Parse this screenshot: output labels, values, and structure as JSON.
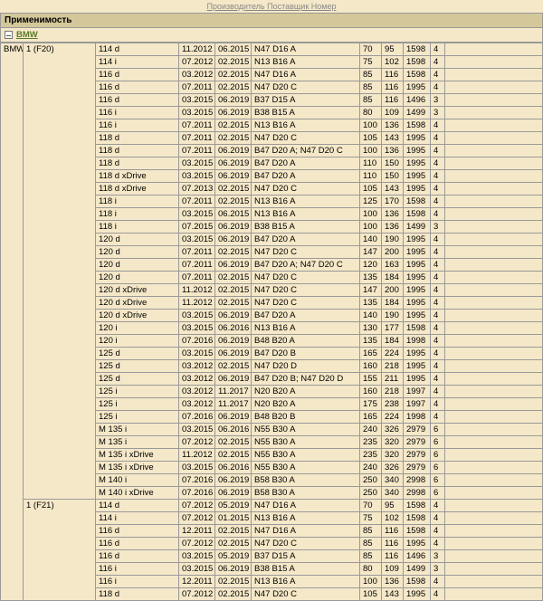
{
  "top_links": "Производитель Поставщик Номер",
  "section_title": "Применимость",
  "brand": "BMW",
  "maker": "BMW",
  "groups": [
    {
      "model": "1 (F20)",
      "rows": [
        {
          "v": "114 d",
          "f": "11.2012",
          "t": "06.2015",
          "e": "N47 D16 A",
          "a": 70,
          "b": 95,
          "c": 1598,
          "d": 4
        },
        {
          "v": "114 i",
          "f": "07.2012",
          "t": "02.2015",
          "e": "N13 B16 A",
          "a": 75,
          "b": 102,
          "c": 1598,
          "d": 4
        },
        {
          "v": "116 d",
          "f": "03.2012",
          "t": "02.2015",
          "e": "N47 D16 A",
          "a": 85,
          "b": 116,
          "c": 1598,
          "d": 4
        },
        {
          "v": "116 d",
          "f": "07.2011",
          "t": "02.2015",
          "e": "N47 D20 C",
          "a": 85,
          "b": 116,
          "c": 1995,
          "d": 4
        },
        {
          "v": "116 d",
          "f": "03.2015",
          "t": "06.2019",
          "e": "B37 D15 A",
          "a": 85,
          "b": 116,
          "c": 1496,
          "d": 3
        },
        {
          "v": "116 i",
          "f": "03.2015",
          "t": "06.2019",
          "e": "B38 B15 A",
          "a": 80,
          "b": 109,
          "c": 1499,
          "d": 3
        },
        {
          "v": "116 i",
          "f": "07.2011",
          "t": "02.2015",
          "e": "N13 B16 A",
          "a": 100,
          "b": 136,
          "c": 1598,
          "d": 4
        },
        {
          "v": "118 d",
          "f": "07.2011",
          "t": "02.2015",
          "e": "N47 D20 C",
          "a": 105,
          "b": 143,
          "c": 1995,
          "d": 4
        },
        {
          "v": "118 d",
          "f": "07.2011",
          "t": "06.2019",
          "e": "B47 D20 A; N47 D20 C",
          "a": 100,
          "b": 136,
          "c": 1995,
          "d": 4
        },
        {
          "v": "118 d",
          "f": "03.2015",
          "t": "06.2019",
          "e": "B47 D20 A",
          "a": 110,
          "b": 150,
          "c": 1995,
          "d": 4
        },
        {
          "v": "118 d xDrive",
          "f": "03.2015",
          "t": "06.2019",
          "e": "B47 D20 A",
          "a": 110,
          "b": 150,
          "c": 1995,
          "d": 4
        },
        {
          "v": "118 d xDrive",
          "f": "07.2013",
          "t": "02.2015",
          "e": "N47 D20 C",
          "a": 105,
          "b": 143,
          "c": 1995,
          "d": 4
        },
        {
          "v": "118 i",
          "f": "07.2011",
          "t": "02.2015",
          "e": "N13 B16 A",
          "a": 125,
          "b": 170,
          "c": 1598,
          "d": 4
        },
        {
          "v": "118 i",
          "f": "03.2015",
          "t": "06.2015",
          "e": "N13 B16 A",
          "a": 100,
          "b": 136,
          "c": 1598,
          "d": 4
        },
        {
          "v": "118 i",
          "f": "07.2015",
          "t": "06.2019",
          "e": "B38 B15 A",
          "a": 100,
          "b": 136,
          "c": 1499,
          "d": 3
        },
        {
          "v": "120 d",
          "f": "03.2015",
          "t": "06.2019",
          "e": "B47 D20 A",
          "a": 140,
          "b": 190,
          "c": 1995,
          "d": 4
        },
        {
          "v": "120 d",
          "f": "07.2011",
          "t": "02.2015",
          "e": "N47 D20 C",
          "a": 147,
          "b": 200,
          "c": 1995,
          "d": 4
        },
        {
          "v": "120 d",
          "f": "07.2011",
          "t": "06.2019",
          "e": "B47 D20 A; N47 D20 C",
          "a": 120,
          "b": 163,
          "c": 1995,
          "d": 4
        },
        {
          "v": "120 d",
          "f": "07.2011",
          "t": "02.2015",
          "e": "N47 D20 C",
          "a": 135,
          "b": 184,
          "c": 1995,
          "d": 4
        },
        {
          "v": "120 d xDrive",
          "f": "11.2012",
          "t": "02.2015",
          "e": "N47 D20 C",
          "a": 147,
          "b": 200,
          "c": 1995,
          "d": 4
        },
        {
          "v": "120 d xDrive",
          "f": "11.2012",
          "t": "02.2015",
          "e": "N47 D20 C",
          "a": 135,
          "b": 184,
          "c": 1995,
          "d": 4
        },
        {
          "v": "120 d xDrive",
          "f": "03.2015",
          "t": "06.2019",
          "e": "B47 D20 A",
          "a": 140,
          "b": 190,
          "c": 1995,
          "d": 4
        },
        {
          "v": "120 i",
          "f": "03.2015",
          "t": "06.2016",
          "e": "N13 B16 A",
          "a": 130,
          "b": 177,
          "c": 1598,
          "d": 4
        },
        {
          "v": "120 i",
          "f": "07.2016",
          "t": "06.2019",
          "e": "B48 B20 A",
          "a": 135,
          "b": 184,
          "c": 1998,
          "d": 4
        },
        {
          "v": "125 d",
          "f": "03.2015",
          "t": "06.2019",
          "e": "B47 D20 B",
          "a": 165,
          "b": 224,
          "c": 1995,
          "d": 4
        },
        {
          "v": "125 d",
          "f": "03.2012",
          "t": "02.2015",
          "e": "N47 D20 D",
          "a": 160,
          "b": 218,
          "c": 1995,
          "d": 4
        },
        {
          "v": "125 d",
          "f": "03.2012",
          "t": "06.2019",
          "e": "B47 D20 B; N47 D20 D",
          "a": 155,
          "b": 211,
          "c": 1995,
          "d": 4
        },
        {
          "v": "125 i",
          "f": "03.2012",
          "t": "11.2017",
          "e": "N20 B20 A",
          "a": 160,
          "b": 218,
          "c": 1997,
          "d": 4
        },
        {
          "v": "125 i",
          "f": "03.2012",
          "t": "11.2017",
          "e": "N20 B20 A",
          "a": 175,
          "b": 238,
          "c": 1997,
          "d": 4
        },
        {
          "v": "125 i",
          "f": "07.2016",
          "t": "06.2019",
          "e": "B48 B20 B",
          "a": 165,
          "b": 224,
          "c": 1998,
          "d": 4
        },
        {
          "v": "M 135 i",
          "f": "03.2015",
          "t": "06.2016",
          "e": "N55 B30 A",
          "a": 240,
          "b": 326,
          "c": 2979,
          "d": 6
        },
        {
          "v": "M 135 i",
          "f": "07.2012",
          "t": "02.2015",
          "e": "N55 B30 A",
          "a": 235,
          "b": 320,
          "c": 2979,
          "d": 6
        },
        {
          "v": "M 135 i xDrive",
          "f": "11.2012",
          "t": "02.2015",
          "e": "N55 B30 A",
          "a": 235,
          "b": 320,
          "c": 2979,
          "d": 6
        },
        {
          "v": "M 135 i xDrive",
          "f": "03.2015",
          "t": "06.2016",
          "e": "N55 B30 A",
          "a": 240,
          "b": 326,
          "c": 2979,
          "d": 6
        },
        {
          "v": "M 140 i",
          "f": "07.2016",
          "t": "06.2019",
          "e": "B58 B30 A",
          "a": 250,
          "b": 340,
          "c": 2998,
          "d": 6
        },
        {
          "v": "M 140 i xDrive",
          "f": "07.2016",
          "t": "06.2019",
          "e": "B58 B30 A",
          "a": 250,
          "b": 340,
          "c": 2998,
          "d": 6
        }
      ]
    },
    {
      "model": "1 (F21)",
      "rows": [
        {
          "v": "114 d",
          "f": "07.2012",
          "t": "05.2019",
          "e": "N47 D16 A",
          "a": 70,
          "b": 95,
          "c": 1598,
          "d": 4
        },
        {
          "v": "114 i",
          "f": "07.2012",
          "t": "01.2015",
          "e": "N13 B16 A",
          "a": 75,
          "b": 102,
          "c": 1598,
          "d": 4
        },
        {
          "v": "116 d",
          "f": "12.2011",
          "t": "02.2015",
          "e": "N47 D16 A",
          "a": 85,
          "b": 116,
          "c": 1598,
          "d": 4
        },
        {
          "v": "116 d",
          "f": "07.2012",
          "t": "02.2015",
          "e": "N47 D20 C",
          "a": 85,
          "b": 116,
          "c": 1995,
          "d": 4
        },
        {
          "v": "116 d",
          "f": "03.2015",
          "t": "05.2019",
          "e": "B37 D15 A",
          "a": 85,
          "b": 116,
          "c": 1496,
          "d": 3
        },
        {
          "v": "116 i",
          "f": "03.2015",
          "t": "06.2019",
          "e": "B38 B15 A",
          "a": 80,
          "b": 109,
          "c": 1499,
          "d": 3
        },
        {
          "v": "116 i",
          "f": "12.2011",
          "t": "02.2015",
          "e": "N13 B16 A",
          "a": 100,
          "b": 136,
          "c": 1598,
          "d": 4
        },
        {
          "v": "118 d",
          "f": "07.2012",
          "t": "02.2015",
          "e": "N47 D20 C",
          "a": 105,
          "b": 143,
          "c": 1995,
          "d": 4
        }
      ]
    }
  ]
}
